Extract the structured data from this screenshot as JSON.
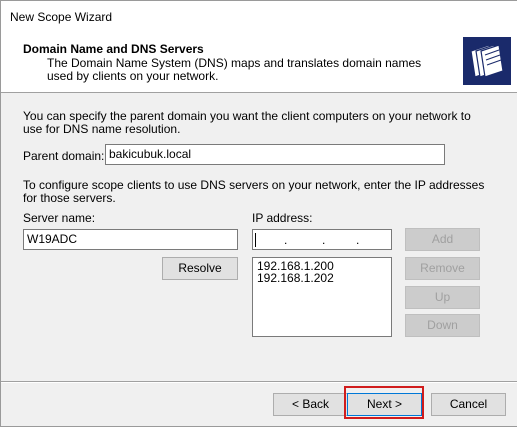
{
  "window": {
    "title": "New Scope Wizard"
  },
  "header": {
    "title": "Domain Name and DNS Servers",
    "description": "The Domain Name System (DNS) maps and translates domain names used by clients on your network.",
    "icon": "dns-servers-icon"
  },
  "parent_domain": {
    "intro": "You can specify the parent domain you want the client computers on your network to use for DNS name resolution.",
    "label": "Parent domain:",
    "value": "bakicubuk.local"
  },
  "dns_servers": {
    "intro": "To configure scope clients to use DNS servers on your network, enter the IP addresses for those servers.",
    "server_name_label": "Server name:",
    "server_name_value": "W19ADC",
    "ip_label": "IP address:",
    "ip_dots": ".",
    "resolve_label": "Resolve",
    "add_label": "Add",
    "remove_label": "Remove",
    "up_label": "Up",
    "down_label": "Down",
    "ip_list": [
      "192.168.1.200",
      "192.168.1.202"
    ]
  },
  "footer": {
    "back_label": "< Back",
    "next_label": "Next >",
    "cancel_label": "Cancel"
  },
  "colors": {
    "highlight_border": "#d01c1c",
    "header_icon_bg": "#1a2a6b"
  }
}
